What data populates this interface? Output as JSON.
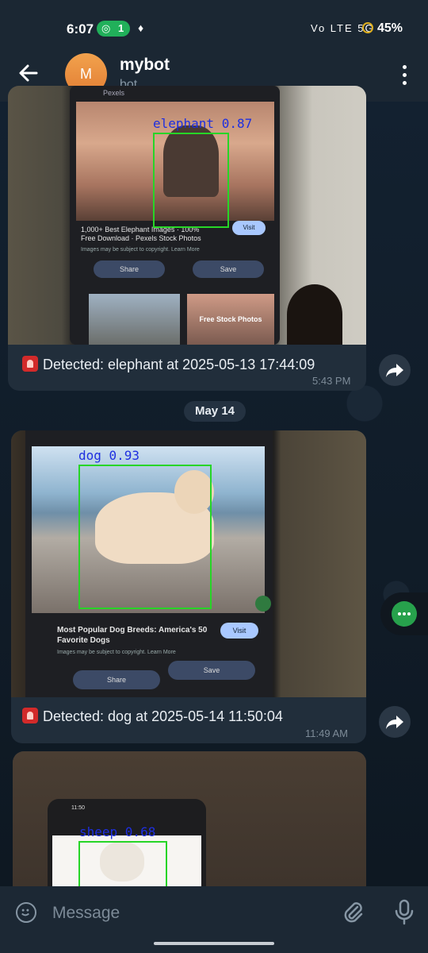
{
  "status_bar": {
    "time": "6:07",
    "hotspot_count": "1",
    "battery": "45%",
    "network": "Vo LTE 5G"
  },
  "header": {
    "back_icon": "arrow-left-icon",
    "avatar_initial": "M",
    "title": "mybot",
    "subtitle": "bot",
    "menu_icon": "more-vertical-icon"
  },
  "messages": [
    {
      "detection_label": "elephant 0.87",
      "phone_text": {
        "source": "Pexels",
        "card_title": "1,000+ Best Elephant Images · 100% Free Download · Pexels Stock Photos",
        "notice": "Images may be subject to copyright. Learn More",
        "visit": "Visit",
        "share": "Share",
        "save": "Save",
        "thumb_caption": "Free Stock Photos"
      },
      "caption": "Detected: elephant at 2025-05-13 17:44:09",
      "time": "5:43 PM"
    },
    {
      "detection_label": "dog 0.93",
      "phone_text": {
        "card_title": "Most Popular Dog Breeds: America's 50 Favorite Dogs",
        "notice": "Images may be subject to copyright. Learn More",
        "visit": "Visit",
        "share": "Share",
        "save": "Save"
      },
      "caption": "Detected: dog at 2025-05-14 11:50:04",
      "time": "11:49 AM"
    },
    {
      "detection_label": "sheep 0.68",
      "phone_text": {
        "time": "11:50"
      }
    }
  ],
  "date_separator": "May 14",
  "input": {
    "placeholder": "Message"
  },
  "colors": {
    "accent": "#27a14c",
    "bubble": "#212e3b",
    "detection_box": "#27d527",
    "detection_text": "#1e2fe0"
  }
}
